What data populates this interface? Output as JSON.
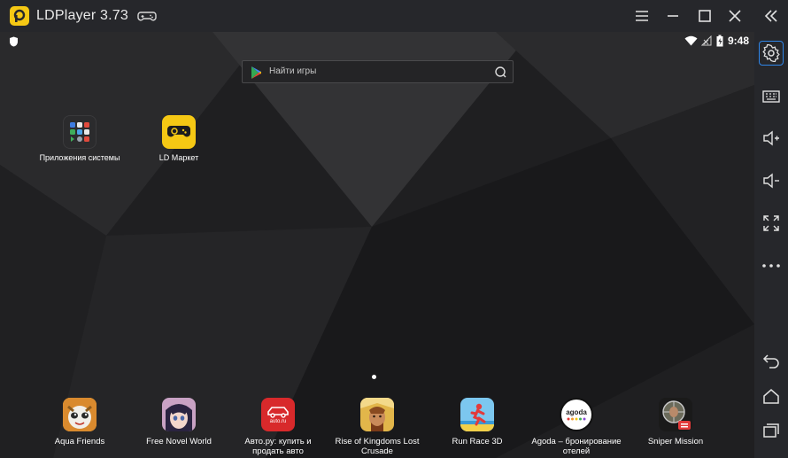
{
  "window": {
    "title": "LDPlayer 3.73"
  },
  "status_bar": {
    "time": "9:48"
  },
  "search": {
    "placeholder": "Найти игры"
  },
  "desktop_apps": [
    {
      "label": "Приложения системы",
      "icon": "apps-folder-icon"
    },
    {
      "label": "LD Маркет",
      "icon": "ld-market-icon"
    }
  ],
  "dock_apps": [
    {
      "label": "Aqua Friends",
      "icon": "aqua-friends-icon"
    },
    {
      "label": "Free Novel World",
      "icon": "free-novel-world-icon"
    },
    {
      "label": "Авто.ру: купить и продать авто",
      "icon": "auto-ru-icon",
      "icon_text": "auto.ru"
    },
    {
      "label": "Rise of Kingdoms Lost Crusade",
      "icon": "rise-of-kingdoms-icon"
    },
    {
      "label": "Run Race 3D",
      "icon": "run-race-icon"
    },
    {
      "label": "Agoda – бронирование отелей",
      "icon": "agoda-icon",
      "icon_text": "agoda"
    },
    {
      "label": "Sniper Mission",
      "icon": "sniper-mission-icon"
    }
  ],
  "colors": {
    "titlebar": "#26272b",
    "accent": "#2f86e8",
    "logo": "#f5c814"
  }
}
